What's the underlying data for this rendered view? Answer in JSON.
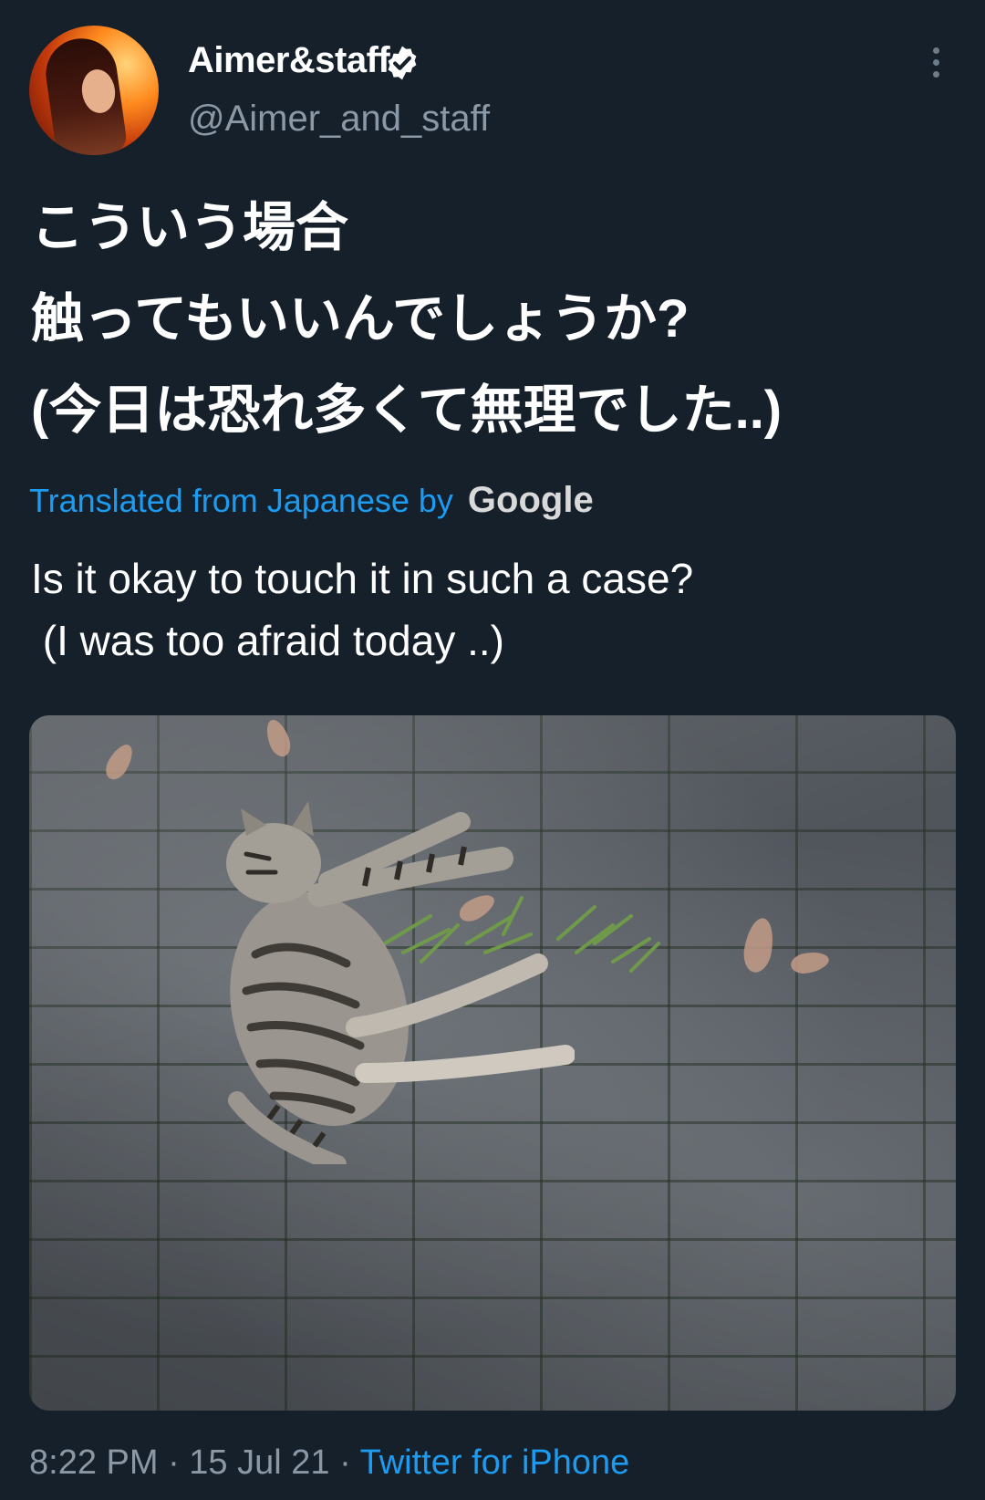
{
  "tweet": {
    "display_name": "Aimer&staff",
    "handle": "@Aimer_and_staff",
    "text_jp": [
      "こういう場合",
      "触ってもいいんでしょうか?",
      "(今日は恐れ多くて無理でした..)"
    ],
    "translated_label": "Translated from Japanese by",
    "translation_provider": "Google",
    "text_en": [
      "Is it okay to touch it in such a case?",
      " (I was too afraid today ..)"
    ],
    "timestamp": "8:22 PM · 15 Jul 21 ·",
    "source": "Twitter for iPhone"
  },
  "icons": {
    "verified": "verified-badge-icon",
    "more": "more-vertical-icon"
  },
  "colors": {
    "background": "#15202b",
    "accent": "#1d9bf0",
    "secondary_text": "#8b98a5"
  }
}
